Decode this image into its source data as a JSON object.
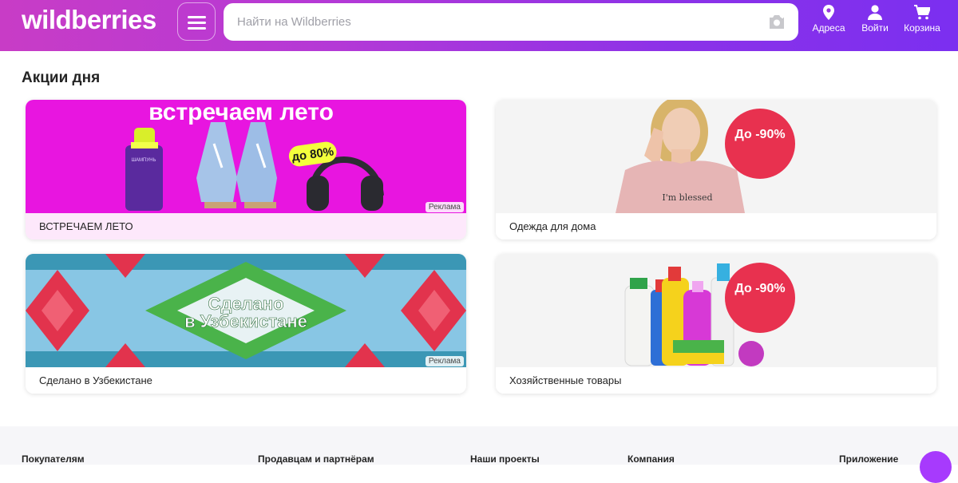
{
  "header": {
    "logo": "wildberries",
    "search_placeholder": "Найти на Wildberries",
    "nav": [
      {
        "label": "Адреса",
        "icon": "map-pin-icon"
      },
      {
        "label": "Войти",
        "icon": "user-icon"
      },
      {
        "label": "Корзина",
        "icon": "cart-icon"
      }
    ]
  },
  "main": {
    "title": "Акции дня",
    "cards": [
      {
        "caption": "ВСТРЕЧАЕМ ЛЕТО",
        "banner_heading": "встречаем лето",
        "banner_badge": "до 80%",
        "product_label": "ШАМПУНЬ",
        "ad": "Реклама"
      },
      {
        "caption": "Одежда для дома",
        "banner_badge": "До -90%",
        "shirt_text": "I'm blessed"
      },
      {
        "caption": "Сделано в Узбекистане",
        "banner_heading_line1": "Сделано",
        "banner_heading_line2": "в Узбекистане",
        "ad": "Реклама"
      },
      {
        "caption": "Хозяйственные товары",
        "banner_badge": "До -90%"
      }
    ]
  },
  "footer": {
    "columns": [
      "Покупателям",
      "Продавцам и партнёрам",
      "Наши проекты",
      "Компания",
      "Приложение"
    ]
  },
  "colors": {
    "brand_pink": "#c83cc6",
    "brand_purple": "#7b2ff0",
    "sale_red": "#e8314f"
  }
}
